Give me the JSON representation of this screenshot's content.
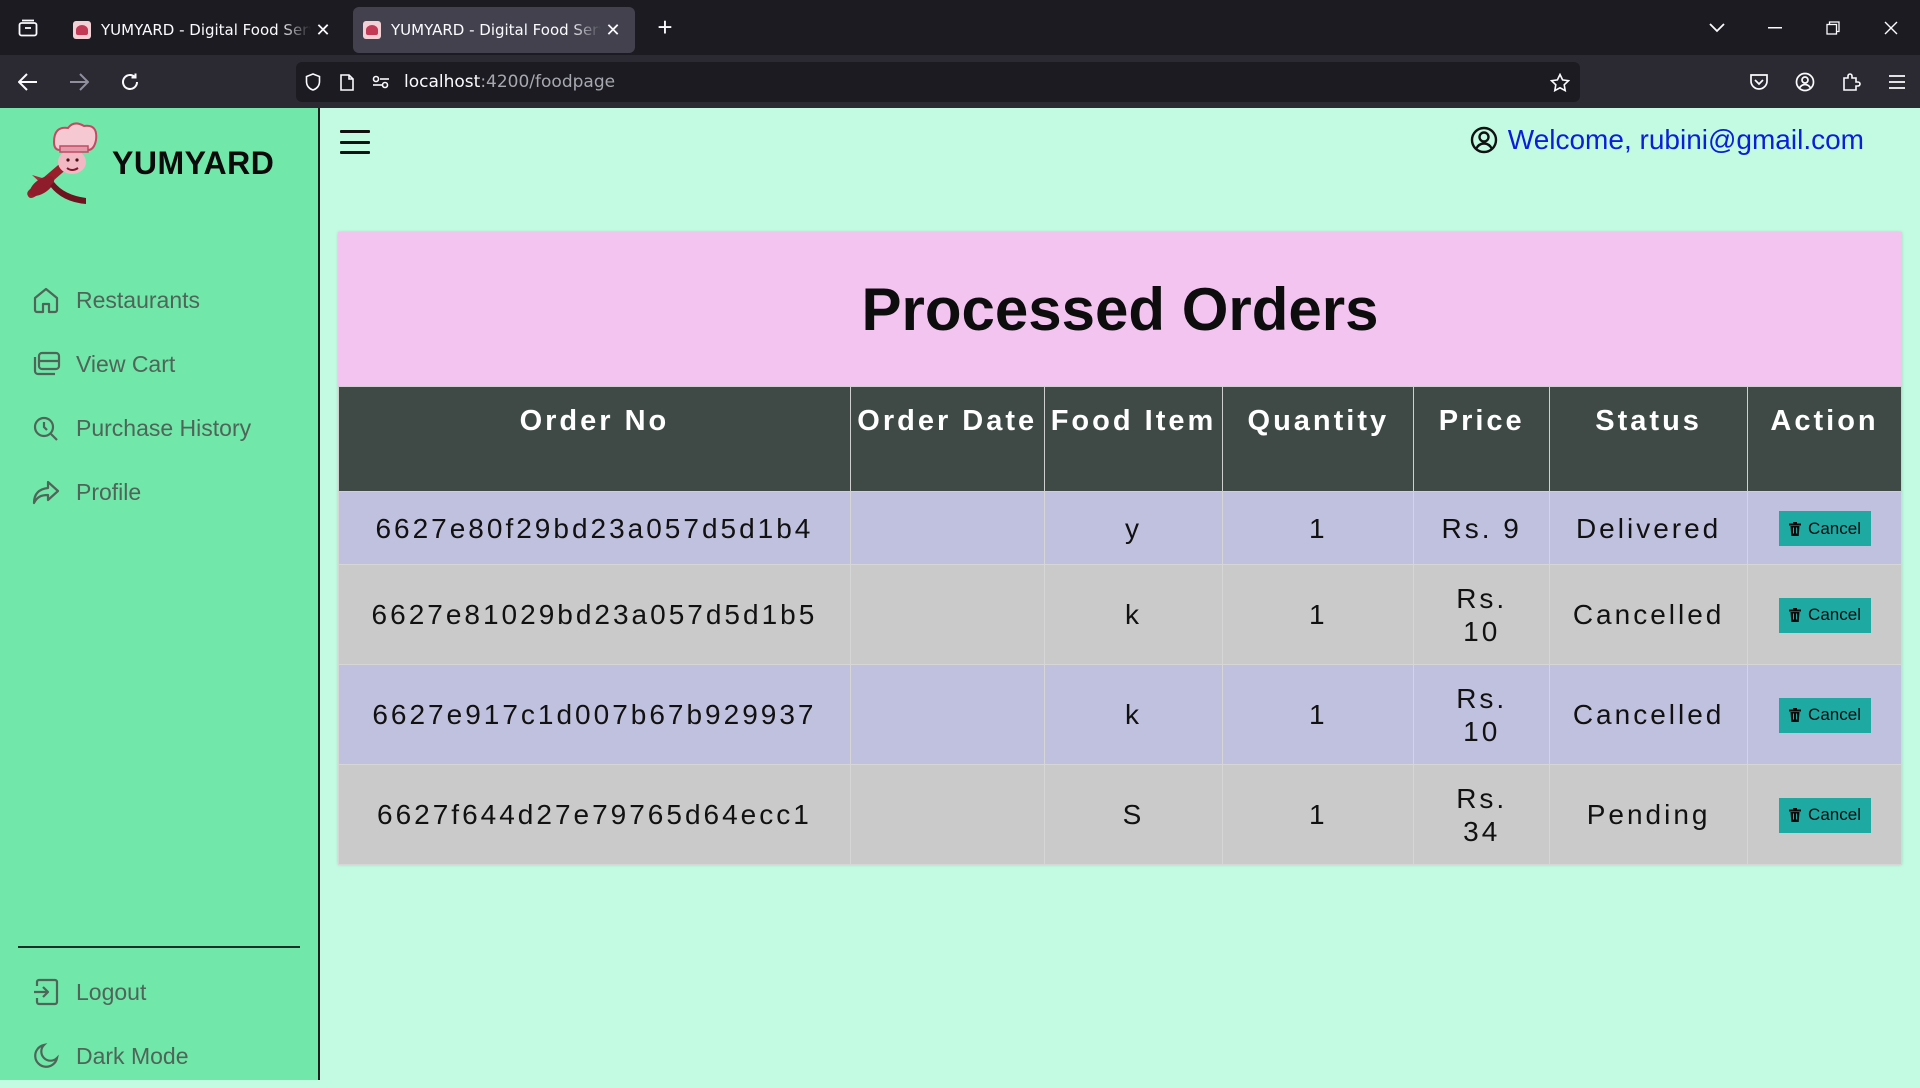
{
  "browser": {
    "tabs": [
      {
        "title": "YUMYARD - Digital Food Service",
        "active": false
      },
      {
        "title": "YUMYARD - Digital Food Service",
        "active": true
      }
    ],
    "url_host": "localhost",
    "url_path": ":4200/foodpage"
  },
  "sidebar": {
    "brand": "YUMYARD",
    "items": [
      {
        "label": "Restaurants",
        "icon": "home-icon"
      },
      {
        "label": "View Cart",
        "icon": "cart-icon"
      },
      {
        "label": "Purchase History",
        "icon": "history-icon"
      },
      {
        "label": "Profile",
        "icon": "share-icon"
      }
    ],
    "bottom": [
      {
        "label": "Logout",
        "icon": "logout-icon"
      },
      {
        "label": "Dark Mode",
        "icon": "moon-icon"
      }
    ]
  },
  "header": {
    "welcome": "Welcome, rubini@gmail.com"
  },
  "orders": {
    "title": "Processed Orders",
    "columns": [
      "Order No",
      "Order Date",
      "Food Item",
      "Quantity",
      "Price",
      "Status",
      "Action"
    ],
    "rows": [
      {
        "order_no": "6627e80f29bd23a057d5d1b4",
        "order_date": "",
        "food_item": "y",
        "quantity": "1",
        "price": "Rs. 9",
        "status": "Delivered",
        "action": "Cancel"
      },
      {
        "order_no": "6627e81029bd23a057d5d1b5",
        "order_date": "",
        "food_item": "k",
        "quantity": "1",
        "price": "Rs. 10",
        "status": "Cancelled",
        "action": "Cancel"
      },
      {
        "order_no": "6627e917c1d007b67b929937",
        "order_date": "",
        "food_item": "k",
        "quantity": "1",
        "price": "Rs. 10",
        "status": "Cancelled",
        "action": "Cancel"
      },
      {
        "order_no": "6627f644d27e79765d64ecc1",
        "order_date": "",
        "food_item": "S",
        "quantity": "1",
        "price": "Rs. 34",
        "status": "Pending",
        "action": "Cancel"
      }
    ]
  },
  "colors": {
    "sidebar_bg": "#72e7aa",
    "page_bg": "#c2fbe2",
    "card_header_bg": "#f3c4f0",
    "table_header_bg": "#3f4a47",
    "row_odd": "#bfc1de",
    "row_even": "#cacaca",
    "cancel_button": "#1fa9a3",
    "welcome_text": "#0b1fd8"
  }
}
